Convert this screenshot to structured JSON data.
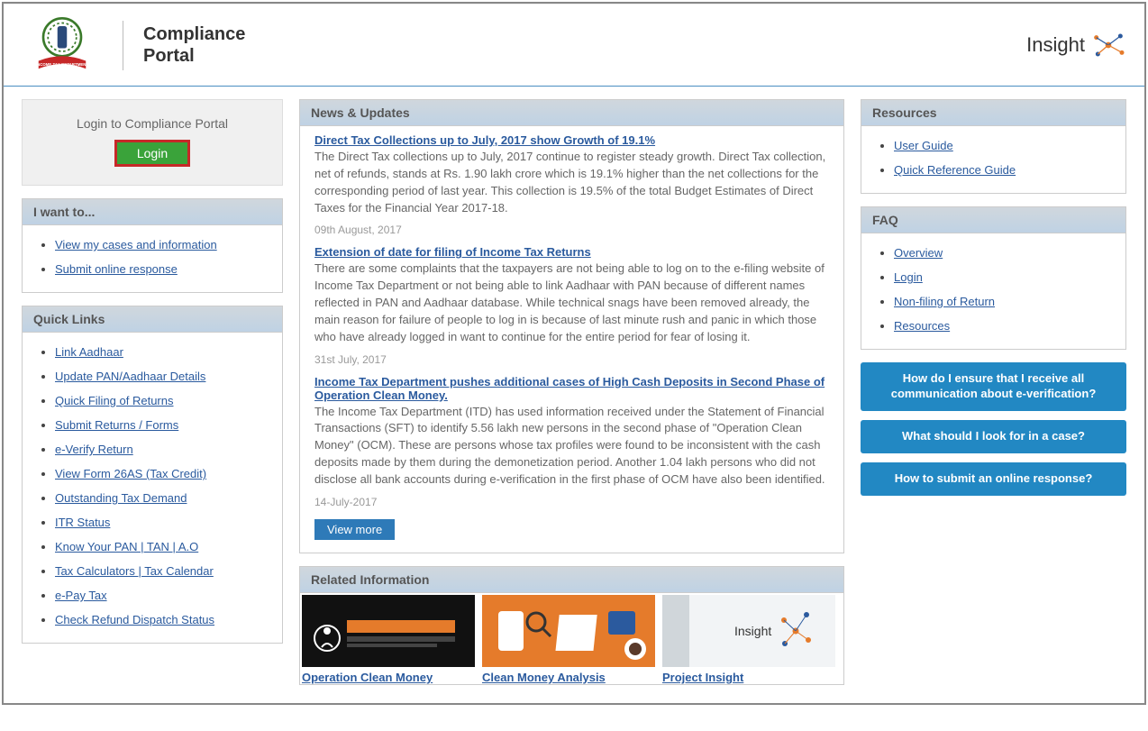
{
  "header": {
    "portal_title": "Compliance\nPortal",
    "insight_label": "Insight"
  },
  "login_box": {
    "title": "Login to Compliance Portal",
    "button": "Login"
  },
  "i_want_to": {
    "title": "I want to...",
    "items": [
      "View my cases and information",
      "Submit online response"
    ]
  },
  "quick_links": {
    "title": "Quick Links",
    "items": [
      "Link Aadhaar",
      "Update PAN/Aadhaar Details",
      "Quick Filing of Returns",
      "Submit Returns / Forms",
      "e-Verify Return",
      "View Form 26AS (Tax Credit)",
      "Outstanding Tax Demand",
      "ITR Status",
      "Know Your PAN | TAN | A.O",
      "Tax Calculators | Tax Calendar",
      "e-Pay Tax",
      "Check Refund Dispatch Status"
    ]
  },
  "news": {
    "title": "News & Updates",
    "items": [
      {
        "title": "Direct Tax Collections up to July, 2017 show Growth of 19.1%",
        "desc": "The Direct Tax collections up to July, 2017 continue to register steady growth. Direct Tax collection, net of refunds, stands at Rs. 1.90 lakh crore which is 19.1% higher than the net collections for the corresponding period of last year. This collection is 19.5% of the total Budget Estimates of Direct Taxes for the Financial Year 2017-18.",
        "date": "09th August, 2017"
      },
      {
        "title": "Extension of date for filing of Income Tax Returns",
        "desc": "There are some complaints that the taxpayers are not being able to log on to the e-filing website of Income Tax Department or not being able to link Aadhaar with PAN because of different names reflected in PAN and Aadhaar database. While technical snags have been removed already, the main reason for failure of people to log in is because of last minute rush and panic in which those who have already logged in want to continue for the entire period for fear of losing it.",
        "date": "31st July, 2017"
      },
      {
        "title": "Income Tax Department pushes additional cases of High Cash Deposits in Second Phase of Operation Clean Money.",
        "desc": "The Income Tax Department (ITD) has used information received under the Statement of Financial Transactions (SFT) to identify 5.56 lakh new persons in the second phase of \"Operation Clean Money\" (OCM). These are persons whose tax profiles were found to be inconsistent with the cash deposits made by them during the demonetization period. Another 1.04 lakh persons who did not disclose all bank accounts during e-verification in the first phase of OCM have also been identified.",
        "date": "14-July-2017"
      }
    ],
    "view_more": "View more"
  },
  "related": {
    "title": "Related Information",
    "items": [
      {
        "label": "Operation Clean Money"
      },
      {
        "label": "Clean Money Analysis"
      },
      {
        "label": "Project Insight"
      }
    ]
  },
  "resources": {
    "title": "Resources",
    "items": [
      "User Guide",
      "Quick Reference Guide"
    ]
  },
  "faq": {
    "title": "FAQ",
    "items": [
      "Overview",
      "Login",
      "Non-filing of Return",
      "Resources"
    ]
  },
  "help_buttons": [
    "How do I ensure that I receive all communication about e-verification?",
    "What should I look for in a case?",
    "How to submit an online response?"
  ]
}
